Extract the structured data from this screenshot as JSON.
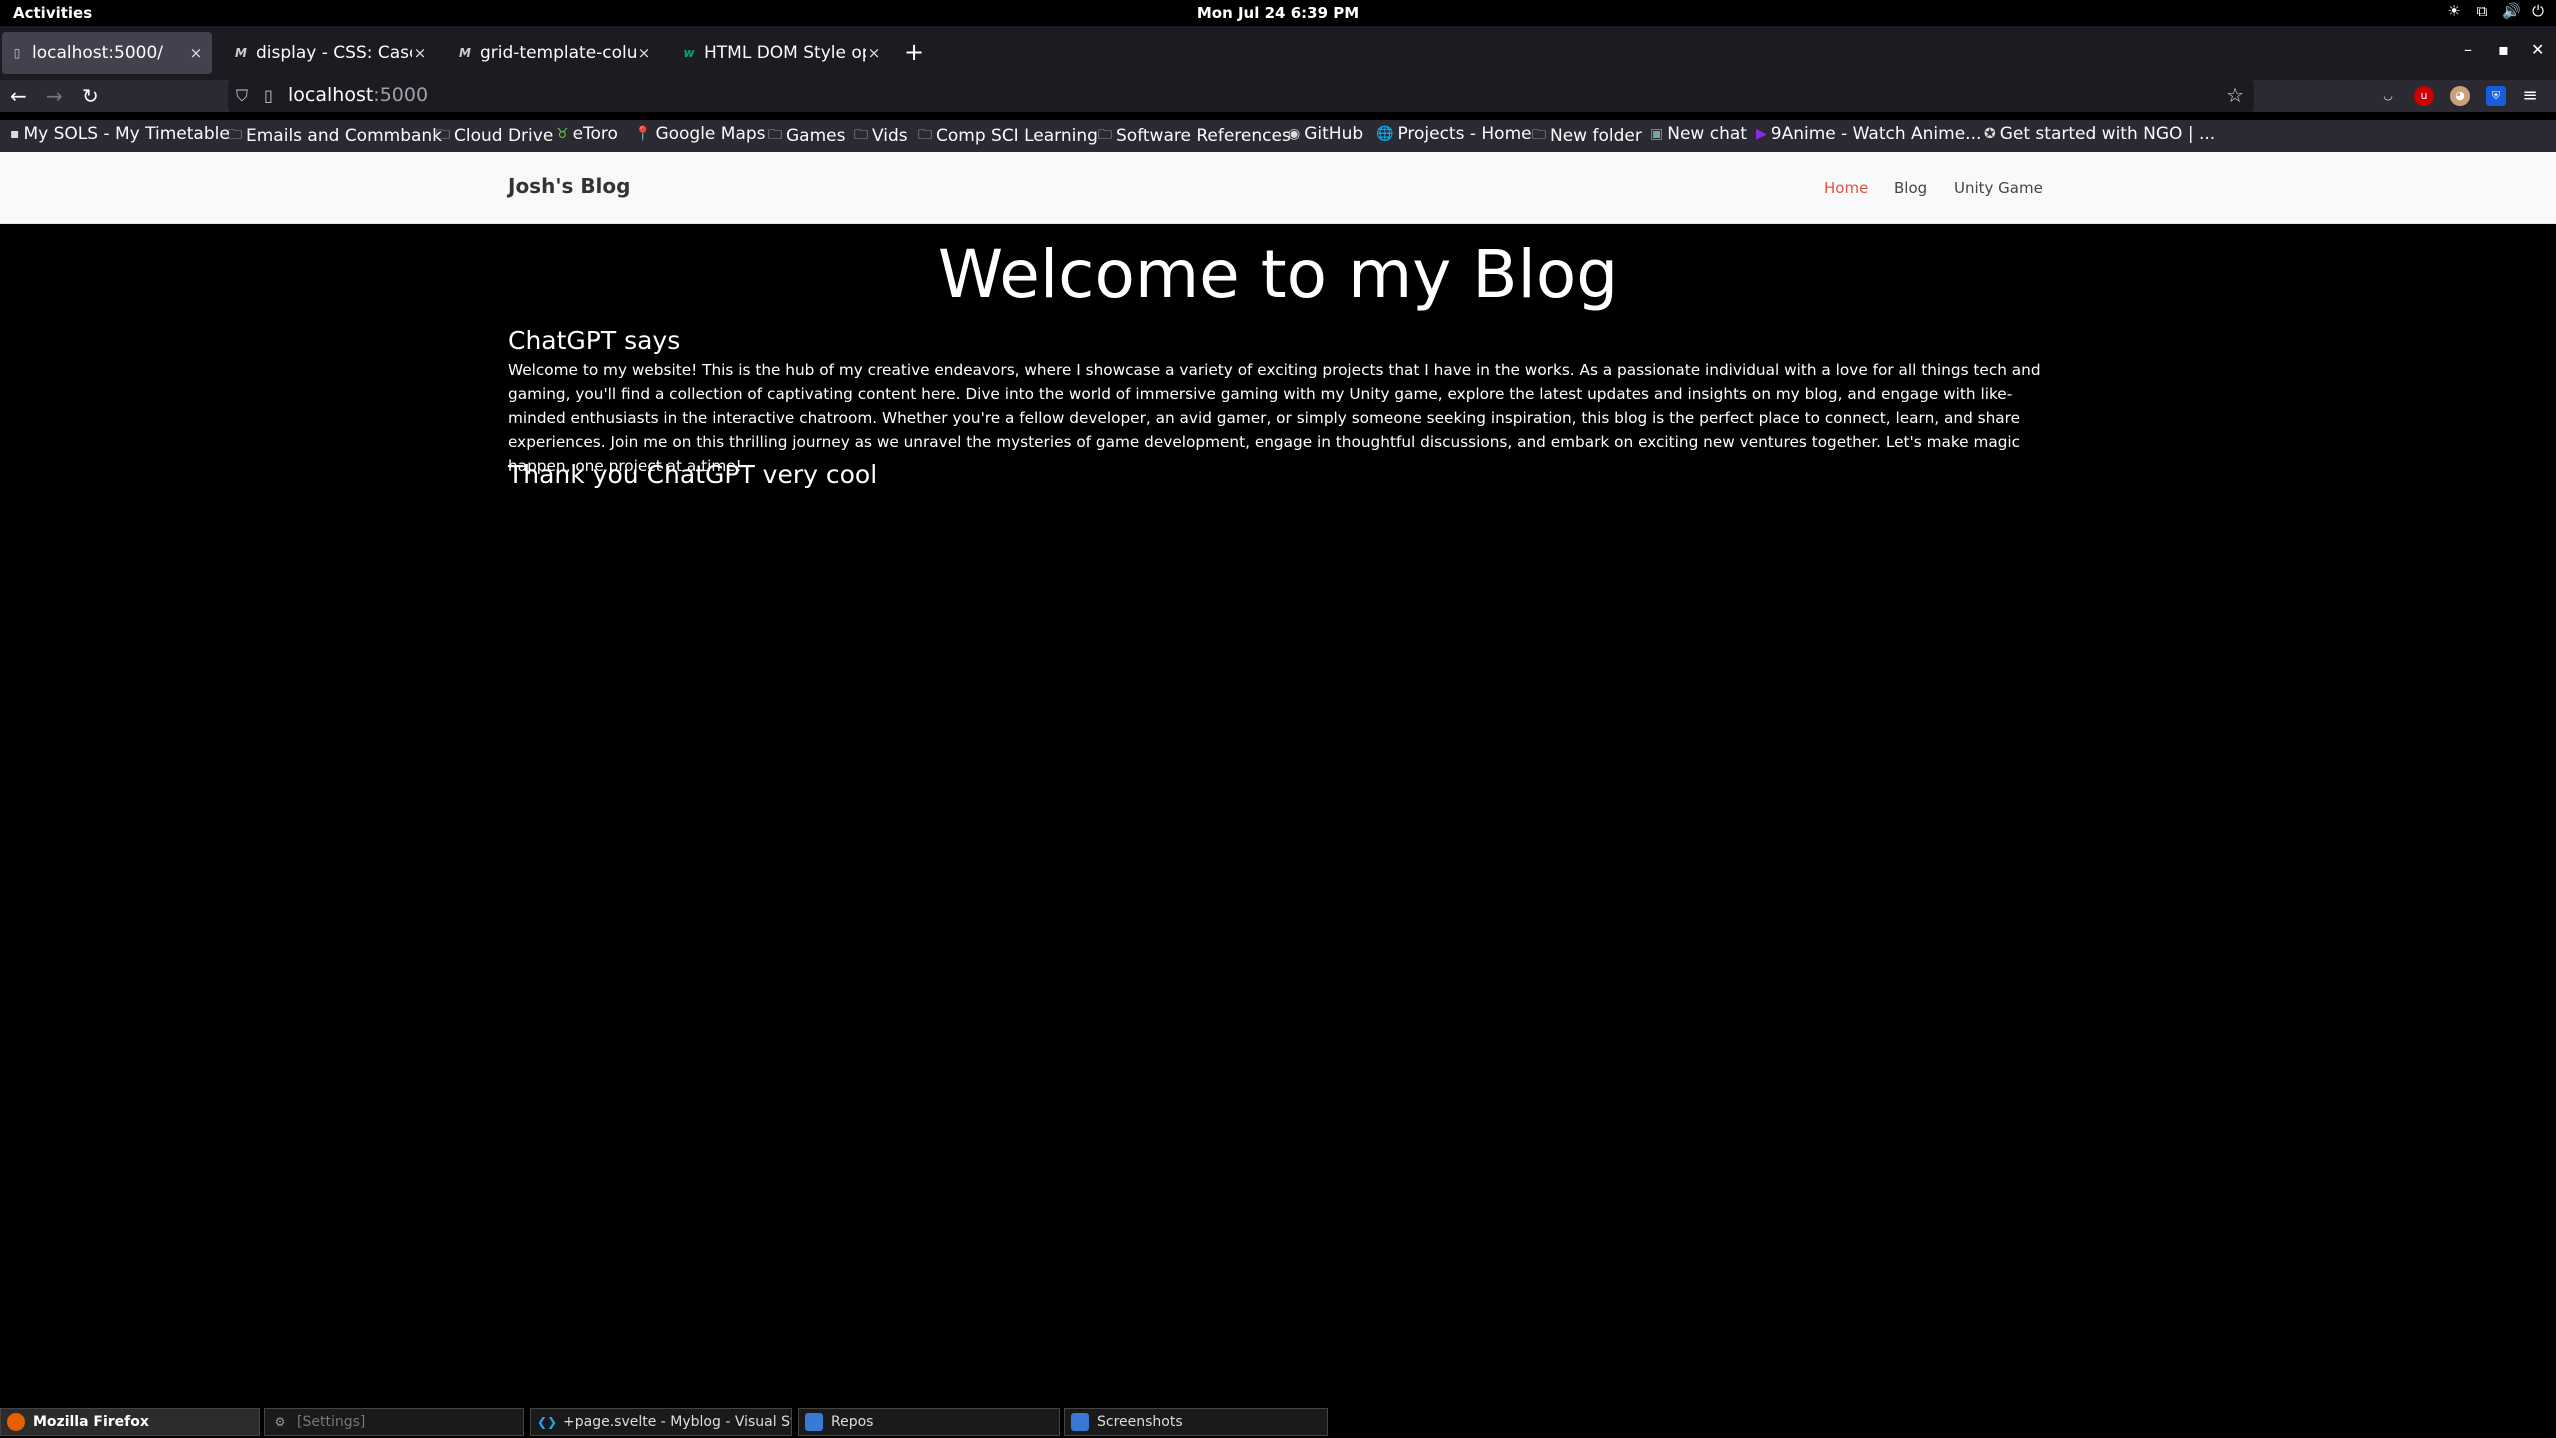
{
  "system": {
    "activities": "Activities",
    "clock": "Mon Jul 24    6:39 PM",
    "tray_icons": [
      "brightness-icon",
      "network-icon",
      "volume-icon",
      "power-icon"
    ]
  },
  "tabs": [
    {
      "title": "localhost:5000/",
      "favicon": "page-icon"
    },
    {
      "title": "display - CSS: Cascading Style Sheets | MDN",
      "favicon": "mdn-icon"
    },
    {
      "title": "grid-template-columns - CSS",
      "favicon": "mdn-icon"
    },
    {
      "title": "HTML DOM Style opacity",
      "favicon": "w3schools-icon"
    }
  ],
  "address_bar": {
    "host": "localhost",
    "port": ":5000"
  },
  "bookmarks": [
    {
      "label": "My SOLS - My Timetable",
      "icon": "site-icon"
    },
    {
      "label": "Emails and Commbank",
      "icon": "folder-icon"
    },
    {
      "label": "Cloud Drive",
      "icon": "folder-icon"
    },
    {
      "label": "eToro",
      "icon": "etoro-icon"
    },
    {
      "label": "Google Maps",
      "icon": "maps-icon"
    },
    {
      "label": "Games",
      "icon": "folder-icon"
    },
    {
      "label": "Vids",
      "icon": "folder-icon"
    },
    {
      "label": "Comp SCI Learning",
      "icon": "folder-icon"
    },
    {
      "label": "Software References",
      "icon": "folder-icon"
    },
    {
      "label": "GitHub",
      "icon": "github-icon"
    },
    {
      "label": "Projects - Home",
      "icon": "globe-icon"
    },
    {
      "label": "New folder",
      "icon": "folder-icon"
    },
    {
      "label": "New chat",
      "icon": "chatgpt-icon"
    },
    {
      "label": "9Anime - Watch Anime...",
      "icon": "play-icon"
    },
    {
      "label": "Get started with NGO | ...",
      "icon": "ngo-icon"
    }
  ],
  "site": {
    "brand": "Josh's Blog",
    "nav": [
      {
        "label": "Home",
        "active": true
      },
      {
        "label": "Blog",
        "active": false
      },
      {
        "label": "Unity Game",
        "active": false
      }
    ],
    "title": "Welcome to my Blog",
    "section_heading": "ChatGPT says",
    "body": "Welcome to my website! This is the hub of my creative endeavors, where I showcase a variety of exciting projects that I have in the works. As a passionate individual with a love for all things tech and gaming, you'll find a collection of captivating content here. Dive into the world of immersive gaming with my Unity game, explore the latest updates and insights on my blog, and engage with like-minded enthusiasts in the interactive chatroom. Whether you're a fellow developer, an avid gamer, or simply someone seeking inspiration, this blog is the perfect place to connect, learn, and share experiences. Join me on this thrilling journey as we unravel the mysteries of game development, engage in thoughtful discussions, and embark on exciting new ventures together. Let's make magic happen, one project at a time!",
    "closing": "Thank you ChatGPT very cool",
    "accent_color": "#e1533c"
  },
  "taskbar": [
    {
      "label": "Mozilla Firefox",
      "icon": "firefox-icon",
      "active": true
    },
    {
      "label": "[Settings]",
      "icon": "settings-icon",
      "active": false
    },
    {
      "label": "+page.svelte - Myblog - Visual Studio Code",
      "icon": "vscode-icon",
      "active": false
    },
    {
      "label": "Repos",
      "icon": "files-icon",
      "active": false
    },
    {
      "label": "Screenshots",
      "icon": "files-icon",
      "active": false
    }
  ]
}
